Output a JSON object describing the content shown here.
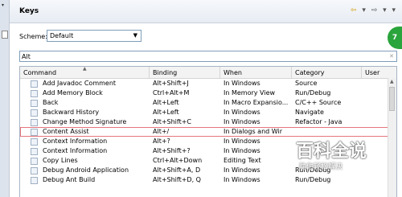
{
  "header": {
    "title": "Keys",
    "nav_back": "⇦",
    "nav_rest": "▾ ⇨ ▾ ▾"
  },
  "scheme": {
    "label": "Scheme:",
    "value": "Default"
  },
  "filter": {
    "value": "Alt"
  },
  "table": {
    "columns": [
      "Command",
      "Binding",
      "When",
      "Category",
      "User"
    ],
    "rows": [
      [
        "Add Javadoc Comment",
        "Alt+Shift+J",
        "In Windows",
        "Source",
        ""
      ],
      [
        "Add Memory Block",
        "Ctrl+Alt+M",
        "In Memory View",
        "Run/Debug",
        ""
      ],
      [
        "Back",
        "Alt+Left",
        "In Macro Expansio...",
        "C/C++ Source",
        ""
      ],
      [
        "Backward History",
        "Alt+Left",
        "In Windows",
        "Navigate",
        ""
      ],
      [
        "Change Method Signature",
        "Alt+Shift+C",
        "In Windows",
        "Refactor - Java",
        ""
      ],
      [
        "Content Assist",
        "Alt+/",
        "In Dialogs and Wir",
        "",
        ""
      ],
      [
        "Context Information",
        "Alt+?",
        "In Windows",
        "",
        ""
      ],
      [
        "Context Information",
        "Alt+Shift+?",
        "In Windows",
        "",
        ""
      ],
      [
        "Copy Lines",
        "Ctrl+Alt+Down",
        "Editing Text",
        "",
        ""
      ],
      [
        "Debug Android Application",
        "Alt+Shift+A, D",
        "In Windows",
        "Run/Debug",
        ""
      ],
      [
        "Debug Ant Build",
        "Alt+Shift+D, Q",
        "In Windows",
        "Run/Debug",
        ""
      ]
    ],
    "selected_row": 5
  },
  "watermark": {
    "main": "百科全说",
    "sub": "助你轻松解决"
  },
  "badge": "7"
}
